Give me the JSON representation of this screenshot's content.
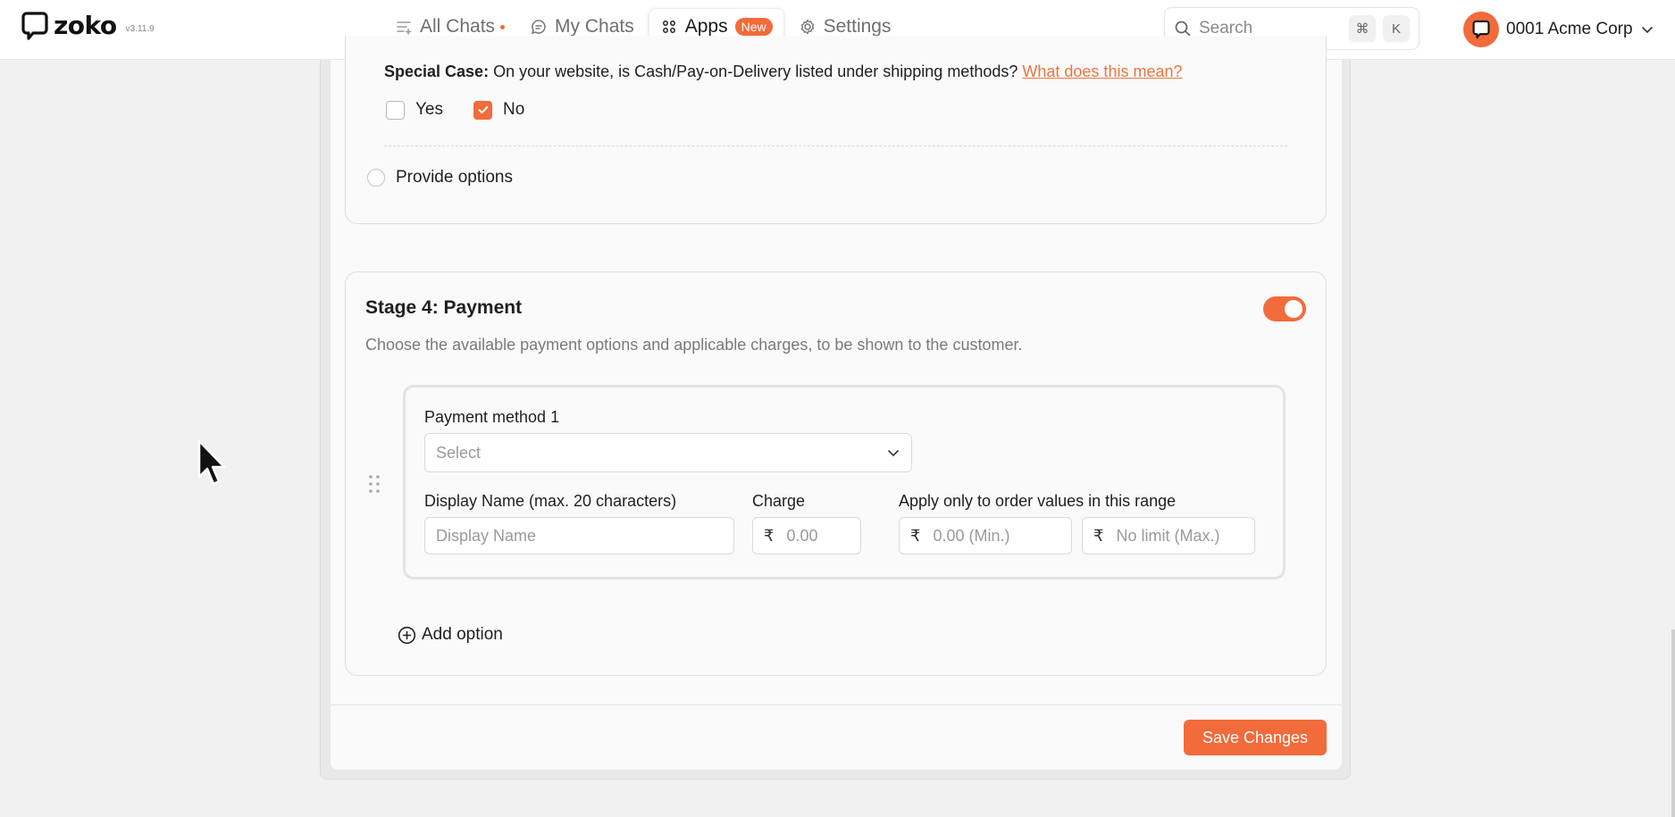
{
  "app": {
    "logo_text": "zoko",
    "version": "v3.11.9"
  },
  "nav": {
    "items": [
      {
        "label": "All Chats",
        "icon": "list-icon"
      },
      {
        "label": "My Chats",
        "icon": "chat-bubble-icon"
      },
      {
        "label": "Apps",
        "icon": "grid-icon",
        "badge": "New",
        "active": true
      },
      {
        "label": "Settings",
        "icon": "gear-icon"
      }
    ]
  },
  "search": {
    "placeholder": "Search",
    "shortcut_keys": [
      "⌘",
      "K"
    ]
  },
  "account": {
    "name": "0001 Acme Corp"
  },
  "shipping": {
    "special_case_label": "Special Case:",
    "special_case_question": "On your website, is Cash/Pay-on-Delivery listed under shipping methods?",
    "help_link": "What does this mean?",
    "options": [
      {
        "label": "Yes",
        "checked": false
      },
      {
        "label": "No",
        "checked": true
      }
    ],
    "provide_options_label": "Provide options"
  },
  "payment": {
    "title": "Stage 4: Payment",
    "enabled": true,
    "description": "Choose the available payment options and applicable charges, to be shown to the customer.",
    "method": {
      "title": "Payment method 1",
      "select_placeholder": "Select",
      "display_name_label": "Display Name (max. 20 characters)",
      "display_name_placeholder": "Display Name",
      "charge_label": "Charge",
      "charge_placeholder": "0.00",
      "range_label": "Apply only to order values in this range",
      "min_placeholder": "0.00 (Min.)",
      "max_placeholder": "No limit (Max.)",
      "currency_symbol": "₹"
    },
    "add_option_label": "Add option"
  },
  "footer": {
    "save_label": "Save Changes"
  },
  "colors": {
    "accent": "#f26b3a",
    "link": "#e8763f"
  }
}
